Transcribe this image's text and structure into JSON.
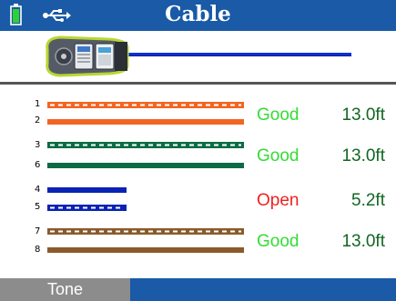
{
  "header": {
    "title": "Cable",
    "battery_icon": "battery-icon",
    "usb_icon": "usb-icon",
    "background_color": "#1a5aa6"
  },
  "device": {
    "icon": "cable-tester-icon"
  },
  "pairs": [
    {
      "pin_a": "1",
      "pin_b": "2",
      "color": "#f26522",
      "status": "Good",
      "length": "13.0ft",
      "status_color": "#33dd33",
      "length_color": "#116622"
    },
    {
      "pin_a": "3",
      "pin_b": "6",
      "color": "#0c6b45",
      "status": "Good",
      "length": "13.0ft",
      "status_color": "#33dd33",
      "length_color": "#116622"
    },
    {
      "pin_a": "4",
      "pin_b": "5",
      "color": "#0a22b5",
      "status": "Open",
      "length": "5.2ft",
      "status_color": "#ee2222",
      "length_color": "#116622"
    },
    {
      "pin_a": "7",
      "pin_b": "8",
      "color": "#8b5a2b",
      "status": "Good",
      "length": "13.0ft",
      "status_color": "#33dd33",
      "length_color": "#116622"
    }
  ],
  "footer": {
    "tone_label": "Tone"
  }
}
